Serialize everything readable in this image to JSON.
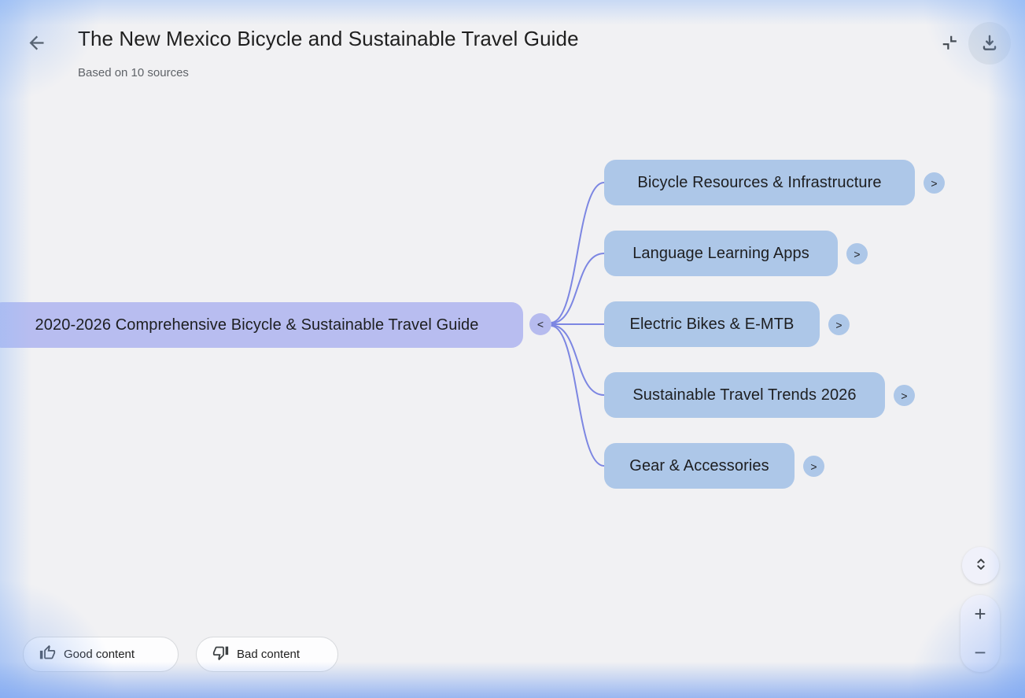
{
  "header": {
    "title": "The New Mexico Bicycle and Sustainable Travel Guide",
    "subtitle": "Based on 10 sources",
    "icons": {
      "back": "arrow-left-icon",
      "collapse": "close-fullscreen-icon",
      "download": "download-icon"
    }
  },
  "mindmap": {
    "root": {
      "label": "2020-2026 Comprehensive Bicycle & Sustainable Travel Guide",
      "collapse_label": "<"
    },
    "children": [
      {
        "label": "Bicycle Resources & Infrastructure",
        "expand_label": ">"
      },
      {
        "label": "Language Learning Apps",
        "expand_label": ">"
      },
      {
        "label": "Electric Bikes & E-MTB",
        "expand_label": ">"
      },
      {
        "label": "Sustainable Travel Trends 2026",
        "expand_label": ">"
      },
      {
        "label": "Gear & Accessories",
        "expand_label": ">"
      }
    ],
    "colors": {
      "root_node": "#b8bdf0",
      "child_node": "#adc7e8",
      "link": "#7c86e2",
      "background": "#f1f1f3",
      "edge_glow": "#8fb4f3"
    }
  },
  "feedback": {
    "good_label": "Good content",
    "bad_label": "Bad content"
  },
  "zoom_controls": {
    "fit_icon": "unfold-more-icon",
    "zoom_in_label": "+",
    "zoom_out_label": "−"
  }
}
